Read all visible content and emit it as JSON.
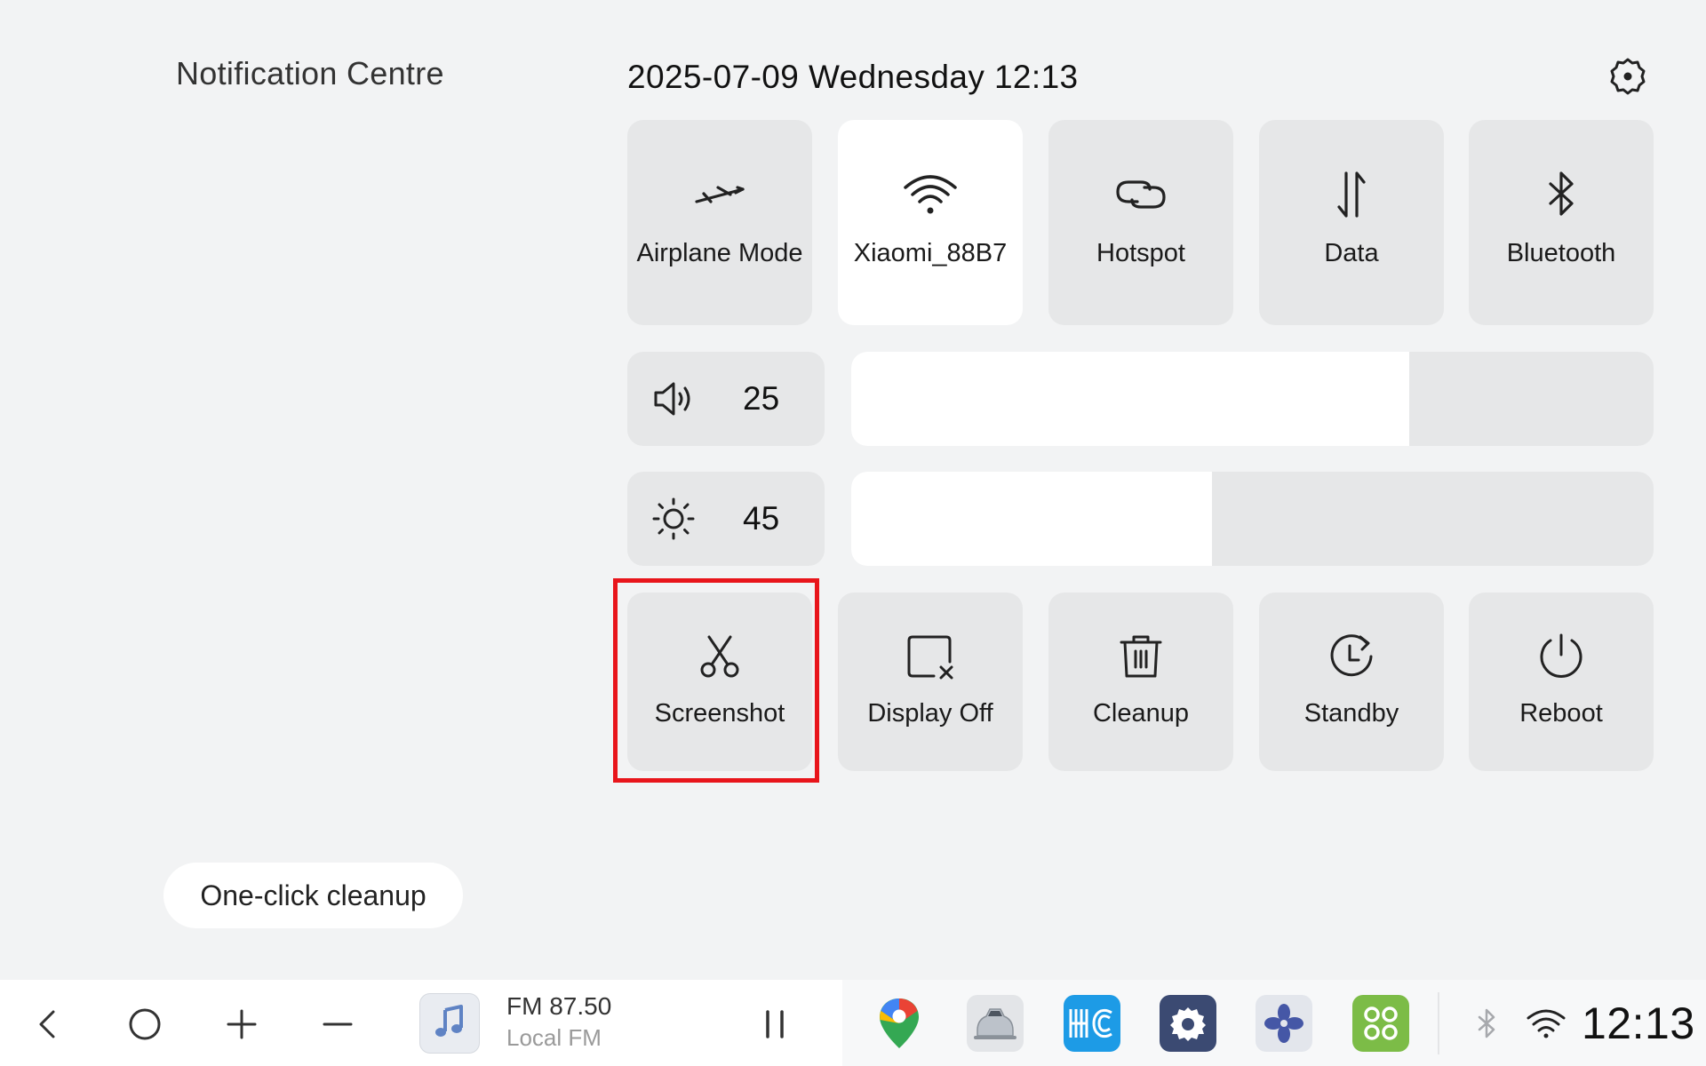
{
  "panel": {
    "title": "Notification Centre",
    "datetime": "2025-07-09 Wednesday 12:13",
    "settings_icon": "settings-gear-icon"
  },
  "toggles": [
    {
      "label": "Airplane Mode",
      "icon": "airplane-icon",
      "active": false
    },
    {
      "label": "Xiaomi_88B7",
      "icon": "wifi-icon",
      "active": true
    },
    {
      "label": "Hotspot",
      "icon": "hotspot-icon",
      "active": false
    },
    {
      "label": "Data",
      "icon": "mobile-data-icon",
      "active": false
    },
    {
      "label": "Bluetooth",
      "icon": "bluetooth-icon",
      "active": false
    }
  ],
  "volume": {
    "value": "25",
    "icon": "speaker-icon",
    "fill_fraction": 0.695
  },
  "brightness": {
    "value": "45",
    "icon": "sun-icon",
    "fill_fraction": 0.45
  },
  "actions": [
    {
      "label": "Screenshot",
      "icon": "scissors-icon",
      "highlighted": true
    },
    {
      "label": "Display Off",
      "icon": "display-off-icon"
    },
    {
      "label": "Cleanup",
      "icon": "trash-icon"
    },
    {
      "label": "Standby",
      "icon": "standby-clock-icon"
    },
    {
      "label": "Reboot",
      "icon": "power-icon"
    }
  ],
  "cleanup_button": "One-click cleanup",
  "taskbar": {
    "nav": [
      "back-icon",
      "home-icon",
      "plus-icon",
      "minus-icon"
    ],
    "media": {
      "title": "FM 87.50",
      "subtitle": "Local FM",
      "art_icon": "music-note-icon",
      "control_icon": "pause-icon"
    },
    "apps": [
      "maps-icon",
      "car-icon",
      "hc-app-icon",
      "settings-app-icon",
      "fan-icon",
      "app-grid-icon"
    ],
    "status": [
      "bluetooth-status-icon",
      "wifi-status-icon"
    ],
    "clock": "12:13"
  },
  "colors": {
    "background": "#f2f3f4",
    "tile": "#e6e7e8",
    "tile_active": "#ffffff",
    "highlight": "#e8151b"
  }
}
